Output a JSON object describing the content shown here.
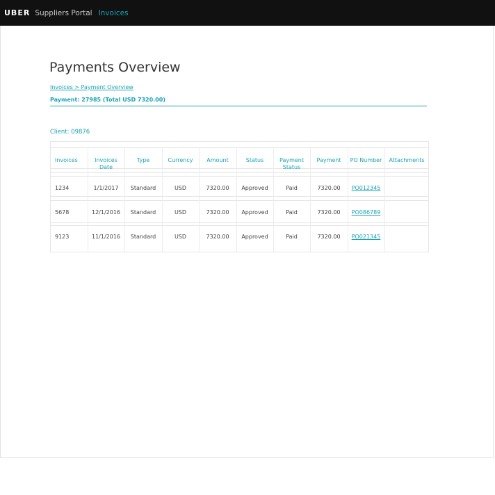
{
  "topbar": {
    "logo": "UBER",
    "portal": "Suppliers Portal",
    "nav_invoices": "Invoices"
  },
  "page": {
    "title": "Payments Overview",
    "breadcrumb": "Invoices > Payment Overview",
    "payment_summary": "Payment: 27985 (Total USD 7320.00)",
    "client": "Client: 09876"
  },
  "table": {
    "headers": [
      "Invoices",
      "Invoices Date",
      "Type",
      "Currency",
      "Amount",
      "Status",
      "Payment Status",
      "Payment",
      "PO Number",
      "Attachments"
    ],
    "rows": [
      [
        "1234",
        "1/1/2017",
        "Standard",
        "USD",
        "7320.00",
        "Approved",
        "Paid",
        "7320.00",
        "PO012345",
        ""
      ],
      [
        "5678",
        "12/1/2016",
        "Standard",
        "USD",
        "7320.00",
        "Approved",
        "Paid",
        "7320.00",
        "PO086789",
        ""
      ],
      [
        "9123",
        "11/1/2016",
        "Standard",
        "USD",
        "7320.00",
        "Approved",
        "Paid",
        "7320.00",
        "PO021345",
        ""
      ]
    ]
  },
  "colors": {
    "accent": "#1aa3b6",
    "topbar": "#111111"
  }
}
